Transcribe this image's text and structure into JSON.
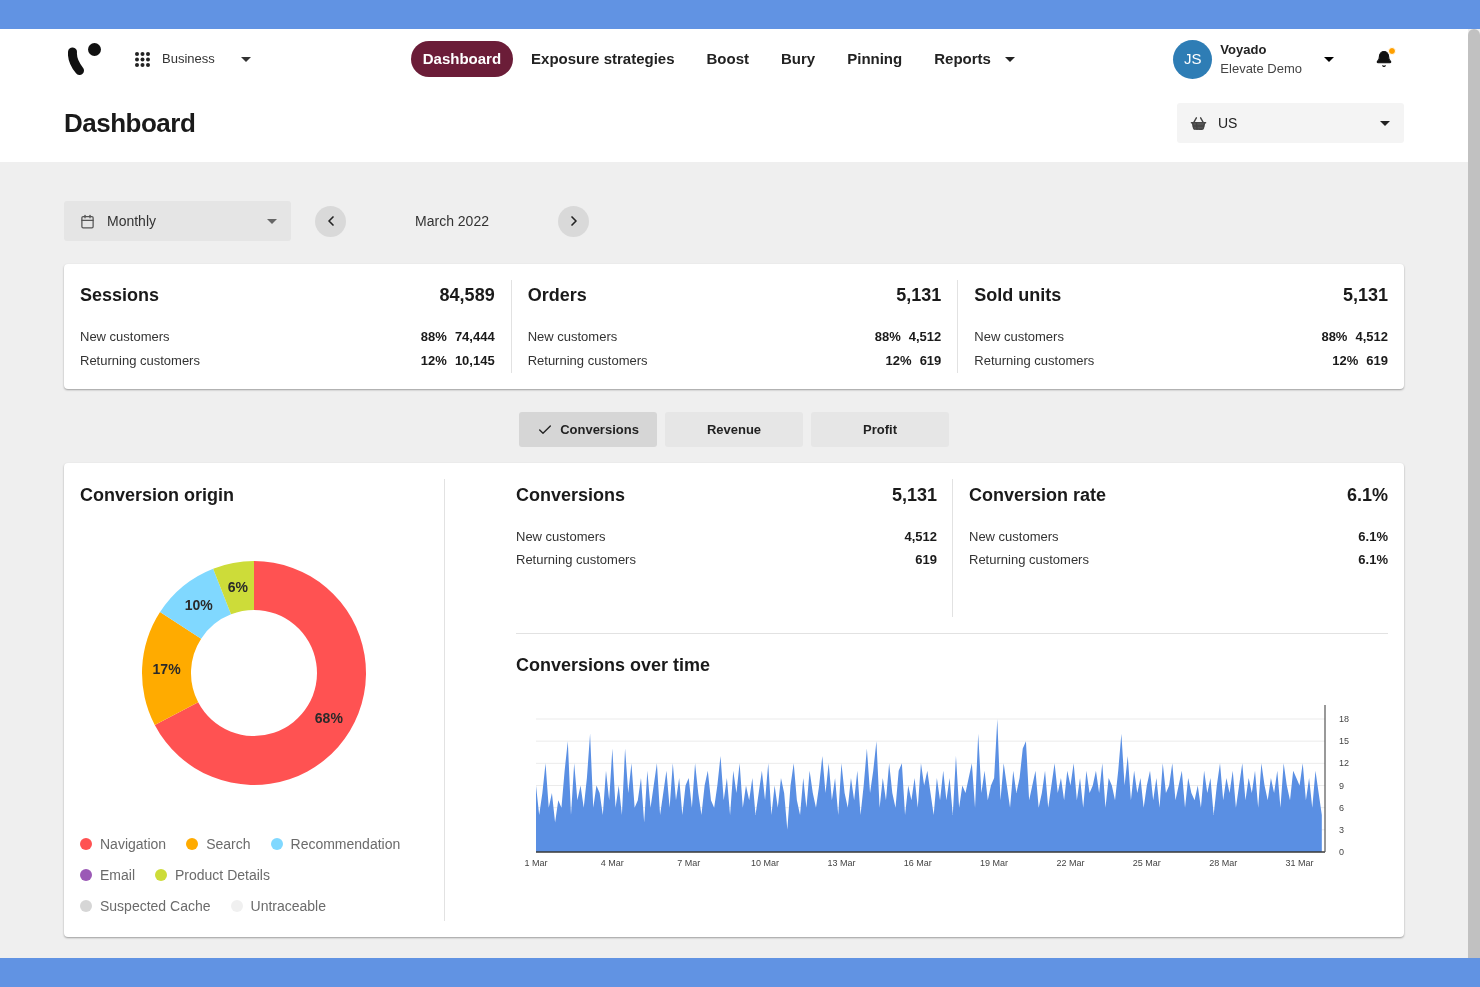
{
  "workspace": {
    "label": "Business"
  },
  "nav": [
    {
      "label": "Dashboard",
      "selected": true,
      "has_menu": false
    },
    {
      "label": "Exposure strategies",
      "selected": false,
      "has_menu": false
    },
    {
      "label": "Boost",
      "selected": false,
      "has_menu": false
    },
    {
      "label": "Bury",
      "selected": false,
      "has_menu": false
    },
    {
      "label": "Pinning",
      "selected": false,
      "has_menu": false
    },
    {
      "label": "Reports",
      "selected": false,
      "has_menu": true
    }
  ],
  "user": {
    "initials": "JS",
    "name": "Voyado",
    "organization": "Elevate Demo"
  },
  "notifications": {
    "unread": true
  },
  "page_title": "Dashboard",
  "store_select": {
    "value": "US"
  },
  "period_select": {
    "value": "Monthly"
  },
  "period": {
    "label": "March 2022"
  },
  "summary": [
    {
      "title": "Sessions",
      "value": "84,589",
      "rows": [
        {
          "label": "New customers",
          "share": "88%",
          "value": "74,444"
        },
        {
          "label": "Returning customers",
          "share": "12%",
          "value": "10,145"
        }
      ]
    },
    {
      "title": "Orders",
      "value": "5,131",
      "rows": [
        {
          "label": "New customers",
          "share": "88%",
          "value": "4,512"
        },
        {
          "label": "Returning customers",
          "share": "12%",
          "value": "619"
        }
      ]
    },
    {
      "title": "Sold units",
      "value": "5,131",
      "rows": [
        {
          "label": "New customers",
          "share": "88%",
          "value": "4,512"
        },
        {
          "label": "Returning customers",
          "share": "12%",
          "value": "619"
        }
      ]
    }
  ],
  "metric_tabs": [
    {
      "label": "Conversions",
      "selected": true
    },
    {
      "label": "Revenue",
      "selected": false
    },
    {
      "label": "Profit",
      "selected": false
    }
  ],
  "conversion_origin": {
    "title": "Conversion origin",
    "chart_data": {
      "type": "donut",
      "categories": [
        "Navigation",
        "Search",
        "Recommendation",
        "Email",
        "Product Details",
        "Suspected Cache",
        "Untraceable"
      ],
      "values": [
        68,
        17,
        10,
        0,
        6,
        0,
        0
      ],
      "colors": [
        "#ff5252",
        "#ffab00",
        "#80d8ff",
        "#9b59b6",
        "#cddc39",
        "#d6d6d6",
        "#f0f0f0"
      ],
      "value_labels": [
        "68%",
        "17%",
        "10%",
        null,
        "6%",
        null,
        null
      ]
    }
  },
  "conversion_stats": [
    {
      "title": "Conversions",
      "value": "5,131",
      "rows": [
        {
          "label": "New customers",
          "value": "4,512"
        },
        {
          "label": "Returning customers",
          "value": "619"
        }
      ]
    },
    {
      "title": "Conversion rate",
      "value": "6.1%",
      "rows": [
        {
          "label": "New customers",
          "value": "6.1%"
        },
        {
          "label": "Returning customers",
          "value": "6.1%"
        }
      ]
    }
  ],
  "conversions_over_time": {
    "title": "Conversions over time",
    "chart_data": {
      "type": "area",
      "categories": [
        "1 Mar",
        null,
        null,
        null,
        null,
        null,
        null,
        null,
        null,
        null,
        null,
        null,
        null,
        null,
        null,
        null,
        null,
        null,
        null,
        null,
        null,
        null,
        null,
        null,
        "4 Mar",
        null,
        null,
        null,
        null,
        null,
        null,
        null,
        null,
        null,
        null,
        null,
        null,
        null,
        null,
        null,
        null,
        null,
        null,
        null,
        null,
        null,
        null,
        null,
        "7 Mar",
        null,
        null,
        null,
        null,
        null,
        null,
        null,
        null,
        null,
        null,
        null,
        null,
        null,
        null,
        null,
        null,
        null,
        null,
        null,
        null,
        null,
        null,
        null,
        "10 Mar",
        null,
        null,
        null,
        null,
        null,
        null,
        null,
        null,
        null,
        null,
        null,
        null,
        null,
        null,
        null,
        null,
        null,
        null,
        null,
        null,
        null,
        null,
        null,
        "13 Mar",
        null,
        null,
        null,
        null,
        null,
        null,
        null,
        null,
        null,
        null,
        null,
        null,
        null,
        null,
        null,
        null,
        null,
        null,
        null,
        null,
        null,
        null,
        null,
        "16 Mar",
        null,
        null,
        null,
        null,
        null,
        null,
        null,
        null,
        null,
        null,
        null,
        null,
        null,
        null,
        null,
        null,
        null,
        null,
        null,
        null,
        null,
        null,
        null,
        "19 Mar",
        null,
        null,
        null,
        null,
        null,
        null,
        null,
        null,
        null,
        null,
        null,
        null,
        null,
        null,
        null,
        null,
        null,
        null,
        null,
        null,
        null,
        null,
        null,
        "22 Mar",
        null,
        null,
        null,
        null,
        null,
        null,
        null,
        null,
        null,
        null,
        null,
        null,
        null,
        null,
        null,
        null,
        null,
        null,
        null,
        null,
        null,
        null,
        null,
        "25 Mar",
        null,
        null,
        null,
        null,
        null,
        null,
        null,
        null,
        null,
        null,
        null,
        null,
        null,
        null,
        null,
        null,
        null,
        null,
        null,
        null,
        null,
        null,
        null,
        "28 Mar",
        null,
        null,
        null,
        null,
        null,
        null,
        null,
        null,
        null,
        null,
        null,
        null,
        null,
        null,
        null,
        null,
        null,
        null,
        null,
        null,
        null,
        null,
        null,
        "31 Mar",
        null,
        null,
        null,
        null,
        null,
        null,
        null
      ],
      "ylim": [
        0,
        18
      ],
      "yticks": [
        0,
        3,
        6,
        9,
        12,
        15,
        18
      ],
      "grid": true,
      "series": [
        {
          "color": "#5a8fe3",
          "values": [
            9,
            5,
            8,
            12,
            6,
            8,
            4,
            7,
            6,
            11,
            15,
            5,
            12,
            7,
            9,
            6,
            10,
            16,
            6,
            9,
            8,
            5,
            11,
            7,
            14,
            6,
            9,
            5,
            14,
            8,
            12,
            6,
            7,
            10,
            4,
            11,
            6,
            9,
            12,
            5,
            8,
            11,
            6,
            12,
            7,
            10,
            5,
            9,
            10,
            6,
            12,
            8,
            5,
            9,
            11,
            7,
            6,
            9,
            13,
            7,
            10,
            5,
            11,
            8,
            12,
            6,
            9,
            7,
            10,
            5,
            8,
            11,
            7,
            12,
            5,
            9,
            6,
            10,
            8,
            3,
            9,
            12,
            7,
            5,
            10,
            6,
            11,
            8,
            6,
            9,
            13,
            8,
            12,
            7,
            10,
            5,
            12,
            8,
            6,
            10,
            7,
            11,
            5,
            9,
            14,
            8,
            11,
            15,
            6,
            10,
            7,
            12,
            8,
            6,
            11,
            12,
            5,
            9,
            7,
            10,
            6,
            12,
            9,
            11,
            8,
            5,
            10,
            7,
            11,
            7,
            10,
            5,
            13,
            6,
            9,
            8,
            10,
            12,
            6,
            16,
            8,
            11,
            7,
            9,
            10,
            18,
            7,
            12,
            9,
            6,
            11,
            8,
            10,
            14,
            15,
            7,
            9,
            11,
            6,
            8,
            11,
            6,
            9,
            12,
            8,
            10,
            7,
            11,
            9,
            12,
            7,
            10,
            6,
            11,
            8,
            9,
            11,
            8,
            12,
            6,
            10,
            9,
            7,
            11,
            16,
            9,
            13,
            7,
            11,
            8,
            10,
            6,
            9,
            11,
            7,
            10,
            6,
            12,
            8,
            9,
            12,
            7,
            9,
            11,
            6,
            10,
            8,
            7,
            9,
            6,
            11,
            8,
            10,
            5,
            9,
            12,
            7,
            10,
            8,
            11,
            6,
            9,
            12,
            7,
            10,
            8,
            11,
            6,
            12,
            9,
            7,
            10,
            8,
            11,
            6,
            12,
            9,
            7,
            11,
            10,
            9,
            12,
            7,
            10,
            6,
            11,
            8,
            5
          ]
        }
      ]
    }
  }
}
